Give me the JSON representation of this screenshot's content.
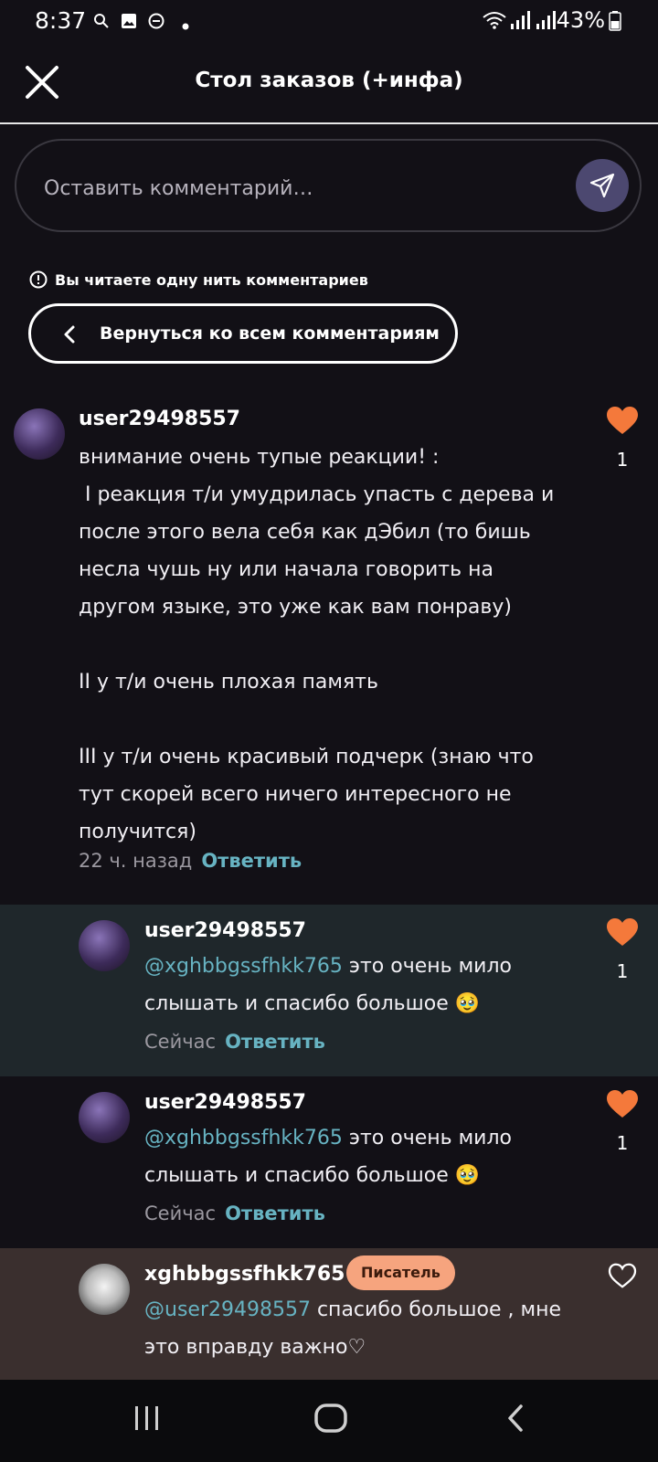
{
  "status_bar": {
    "time": "8:37",
    "battery": "43%"
  },
  "header": {
    "title": "Стол заказов (+инфа)"
  },
  "comment_input": {
    "placeholder": "Оставить комментарий…"
  },
  "thread": {
    "notice": "Вы читаете одну нить комментариев",
    "back_label": "Вернуться ко всем комментариям"
  },
  "comments": [
    {
      "username": "user29498557",
      "body": "внимание очень тупые реакции! :\n I реакция т/и умудрилась упасть с дерева и\nпосле этого вела себя как дЭбил (то бишь\nнесла чушь ну или начала говорить на\nдругом языке, это уже как вам понраву)\n\nII у т/и очень плохая память\n\nIII у т/и очень красивый подчерк (знаю что\nтут скорей всего ничего интересного не\nполучится)",
      "time": "22 ч. назад",
      "reply": "Ответить",
      "likes": "1",
      "liked": true
    },
    {
      "username": "user29498557",
      "mention": "@xghbbgssfhkk765",
      "body_line1": " это очень мило",
      "body_line2": "слышать и спасибо большое 🥹",
      "time": "Сейчас",
      "reply": "Ответить",
      "likes": "1",
      "liked": true
    },
    {
      "username": "user29498557",
      "mention": "@xghbbgssfhkk765",
      "body_line1": " это очень мило",
      "body_line2": "слышать и спасибо большое 🥹",
      "time": "Сейчас",
      "reply": "Ответить",
      "likes": "1",
      "liked": true
    },
    {
      "username": "xghbbgssfhkk765",
      "badge": "Писатель",
      "mention": "@user29498557",
      "body_line1": " спасибо большое , мне",
      "body_line2": "это вправду важно♡",
      "liked": false
    }
  ],
  "colors": {
    "background": "#121016",
    "highlight_reply": "#1f272b",
    "writer_reply": "#3a2f2e",
    "heart": "#f4793b",
    "mention": "#67b3c2",
    "badge": "#f6a47e"
  },
  "icons": {
    "close": "close-icon",
    "send": "send-icon",
    "info": "info-icon",
    "back": "chevron-left-icon",
    "like": "heart-icon"
  }
}
